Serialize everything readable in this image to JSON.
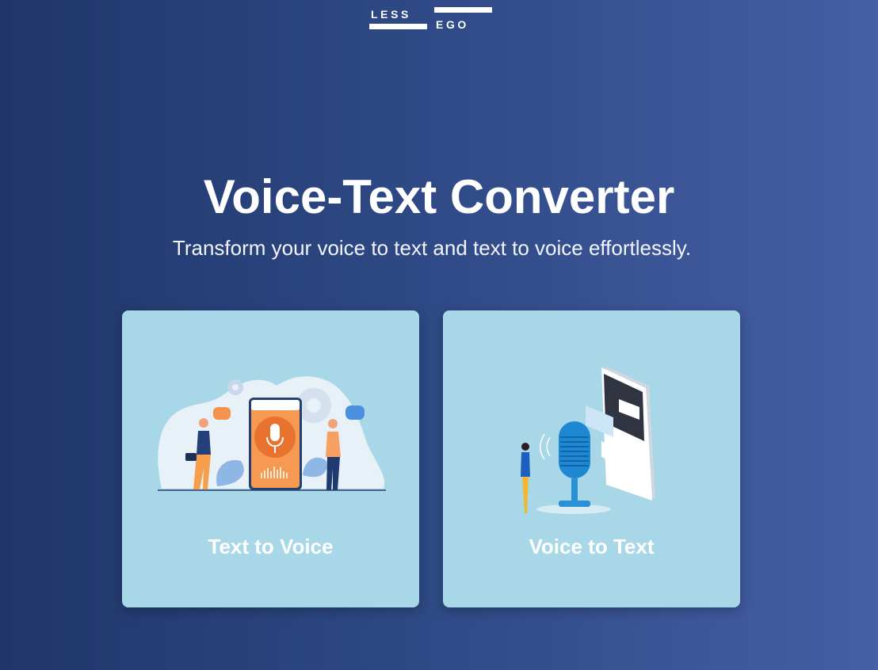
{
  "logo": {
    "line1": "LESS",
    "line2": "EGO"
  },
  "hero": {
    "title": "Voice-Text Converter",
    "subtitle": "Transform your voice to text and text to voice effortlessly."
  },
  "cards": [
    {
      "label": "Text to Voice",
      "illustration": "phone-microphone-people-illustration"
    },
    {
      "label": "Voice to Text",
      "illustration": "studio-microphone-smartphone-illustration"
    }
  ],
  "colors": {
    "background_start": "#20366a",
    "background_end": "#465fa5",
    "card": "#a8d8e8",
    "accent_orange": "#f5924f",
    "accent_blue": "#1e88d3"
  }
}
